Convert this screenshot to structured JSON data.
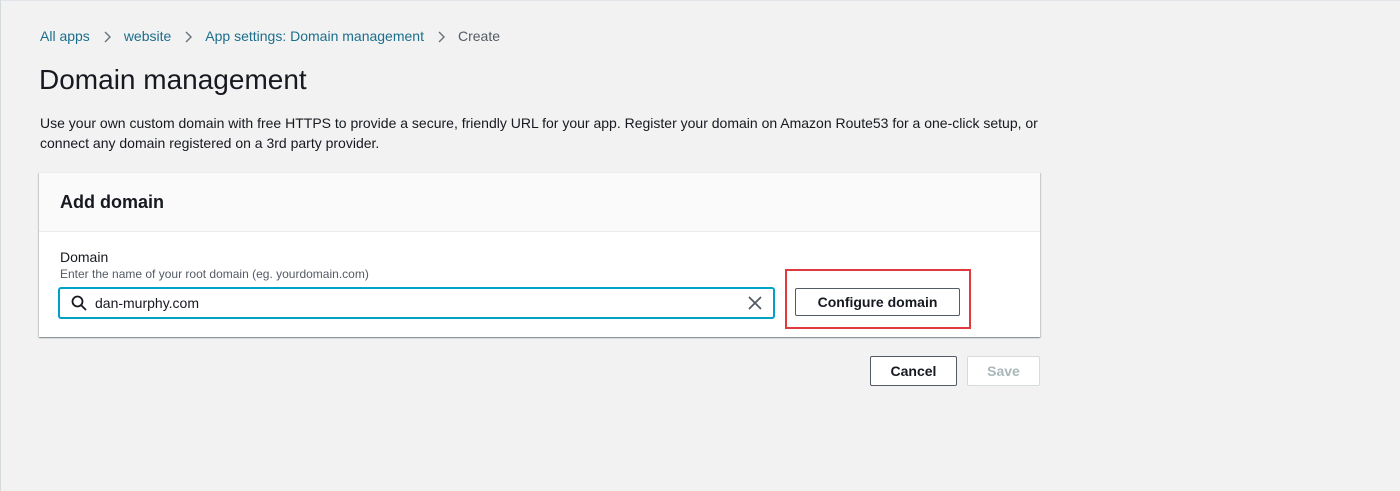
{
  "breadcrumb": {
    "items": [
      {
        "label": "All apps"
      },
      {
        "label": "website"
      },
      {
        "label": "App settings: Domain management"
      },
      {
        "label": "Create"
      }
    ]
  },
  "page": {
    "title": "Domain management",
    "description": "Use your own custom domain with free HTTPS to provide a secure, friendly URL for your app. Register your domain on Amazon Route53 for a one-click setup, or connect any domain registered on a 3rd party provider."
  },
  "add_domain_panel": {
    "title": "Add domain",
    "field_label": "Domain",
    "field_description": "Enter the name of your root domain (eg. yourdomain.com)",
    "input_value": "dan-murphy.com",
    "search_icon": "search-icon",
    "clear_icon": "close-icon",
    "configure_button_label": "Configure domain"
  },
  "footer": {
    "cancel_label": "Cancel",
    "save_label": "Save"
  },
  "colors": {
    "link": "#1b6e8c",
    "focus_border": "#00a1c9",
    "highlight": "#e0393e",
    "disabled_text": "#aab7b8"
  }
}
